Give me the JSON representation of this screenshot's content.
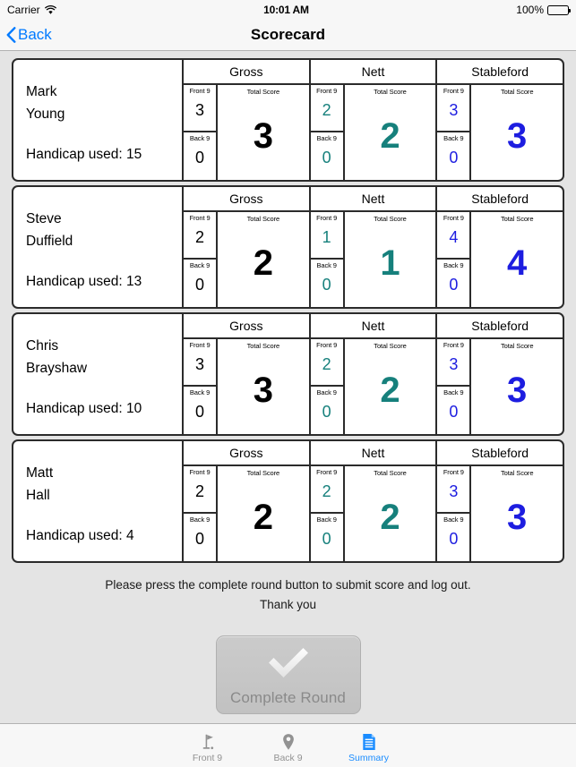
{
  "status_bar": {
    "carrier": "Carrier",
    "wifi_icon": "wifi-icon",
    "time": "10:01 AM",
    "battery_percent": "100%",
    "battery_icon": "battery-full-icon"
  },
  "nav_bar": {
    "back_label": "Back",
    "back_icon": "chevron-left-icon",
    "title": "Scorecard"
  },
  "colors": {
    "gross": "#000000",
    "nett": "#16807C",
    "stableford": "#1D1DE0",
    "accent_blue": "#007aff",
    "tab_active": "#1a8cff",
    "tab_inactive": "#929292",
    "page_background": "#e4e4e4",
    "card_border": "#2b2b2b"
  },
  "column_headers": {
    "gross": "Gross",
    "nett": "Nett",
    "stableford": "Stableford",
    "front": "Front 9",
    "back": "Back 9",
    "total": "Total Score"
  },
  "handicap_prefix": "Handicap used:",
  "players": [
    {
      "first_name": "Mark",
      "last_name": "Young",
      "handicap_label": "Handicap used: 15",
      "handicap": "15",
      "gross": {
        "front": "3",
        "back": "0",
        "total": "3"
      },
      "nett": {
        "front": "2",
        "back": "0",
        "total": "2"
      },
      "stableford": {
        "front": "3",
        "back": "0",
        "total": "3"
      }
    },
    {
      "first_name": "Steve",
      "last_name": "Duffield",
      "handicap_label": "Handicap used: 13",
      "handicap": "13",
      "gross": {
        "front": "2",
        "back": "0",
        "total": "2"
      },
      "nett": {
        "front": "1",
        "back": "0",
        "total": "1"
      },
      "stableford": {
        "front": "4",
        "back": "0",
        "total": "4"
      }
    },
    {
      "first_name": "Chris",
      "last_name": "Brayshaw",
      "handicap_label": "Handicap used: 10",
      "handicap": "10",
      "gross": {
        "front": "3",
        "back": "0",
        "total": "3"
      },
      "nett": {
        "front": "2",
        "back": "0",
        "total": "2"
      },
      "stableford": {
        "front": "3",
        "back": "0",
        "total": "3"
      }
    },
    {
      "first_name": "Matt",
      "last_name": "Hall",
      "handicap_label": "Handicap used: 4",
      "handicap": "4",
      "gross": {
        "front": "2",
        "back": "0",
        "total": "2"
      },
      "nett": {
        "front": "2",
        "back": "0",
        "total": "2"
      },
      "stableford": {
        "front": "3",
        "back": "0",
        "total": "3"
      }
    }
  ],
  "footer": {
    "message_line1": "Please press the complete round button to submit score and log out.",
    "message_line2": "Thank you"
  },
  "complete_round_button": {
    "label": "Complete Round",
    "icon": "checkmark-icon"
  },
  "tab_bar": {
    "items": [
      {
        "label": "Front 9",
        "icon": "golf-flag-icon",
        "active": false
      },
      {
        "label": "Back 9",
        "icon": "map-pin-icon",
        "active": false
      },
      {
        "label": "Summary",
        "icon": "document-icon",
        "active": true
      }
    ]
  }
}
